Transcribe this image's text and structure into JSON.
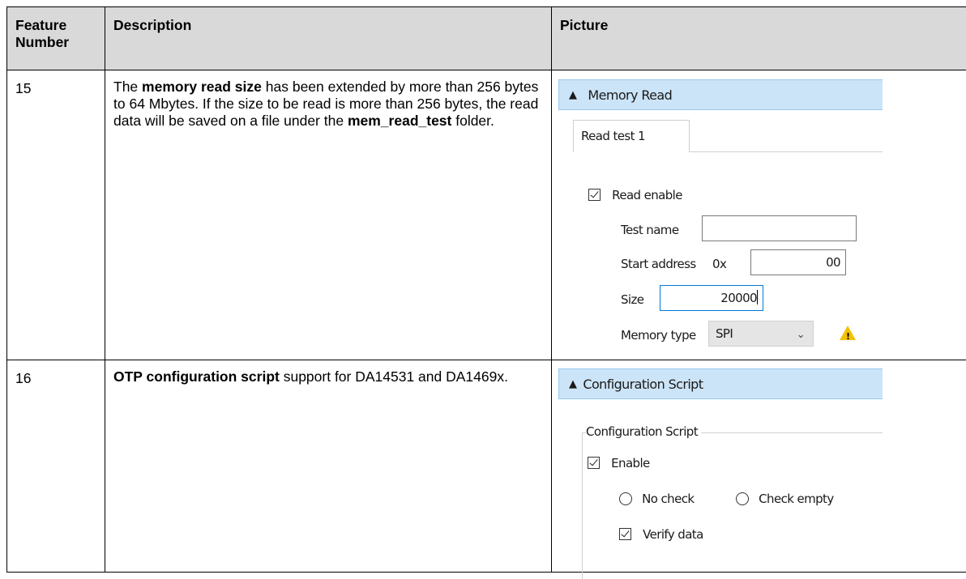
{
  "header": {
    "feature_number": "Feature\nNumber",
    "feature_line1": "Feature",
    "feature_line2": "Number",
    "description": "Description",
    "picture": "Picture"
  },
  "rows": [
    {
      "number": "15",
      "description_parts": [
        {
          "text": "The ",
          "bold": false
        },
        {
          "text": "memory read size",
          "bold": true
        },
        {
          "text": " has been extended by more than 256 bytes to 64 Mbytes. If the size to be read is more than 256 bytes, the read data will be saved on a file under the ",
          "bold": false
        },
        {
          "text": "mem_read_test",
          "bold": true
        },
        {
          "text": " folder.",
          "bold": false
        }
      ],
      "picture": {
        "panel_title": "Memory Read",
        "tab_label": "Read test 1",
        "read_enable_label": "Read enable",
        "read_enable_checked": true,
        "test_name_label": "Test name",
        "test_name_value": "",
        "start_address_label": "Start address",
        "start_address_prefix": "0x",
        "start_address_value": "00",
        "size_label": "Size",
        "size_value": "20000",
        "memory_type_label": "Memory type",
        "memory_type_value": "SPI",
        "warning_icon": "warning-icon",
        "warning_color": "#f2c200"
      }
    },
    {
      "number": "16",
      "description_parts": [
        {
          "text": "OTP configuration script",
          "bold": true
        },
        {
          "text": " support for DA14531 and DA1469x.",
          "bold": false
        }
      ],
      "picture": {
        "panel_title": "Configuration Script",
        "group_label": "Configuration Script",
        "enable_label": "Enable",
        "enable_checked": true,
        "no_check_label": "No check",
        "check_empty_label": "Check empty",
        "verify_data_label": "Verify data",
        "verify_data_checked": true
      }
    }
  ],
  "colors": {
    "header_bg": "#d9d9d9",
    "panel_bar_bg": "#cce4f7",
    "focus_border": "#0078d7"
  }
}
